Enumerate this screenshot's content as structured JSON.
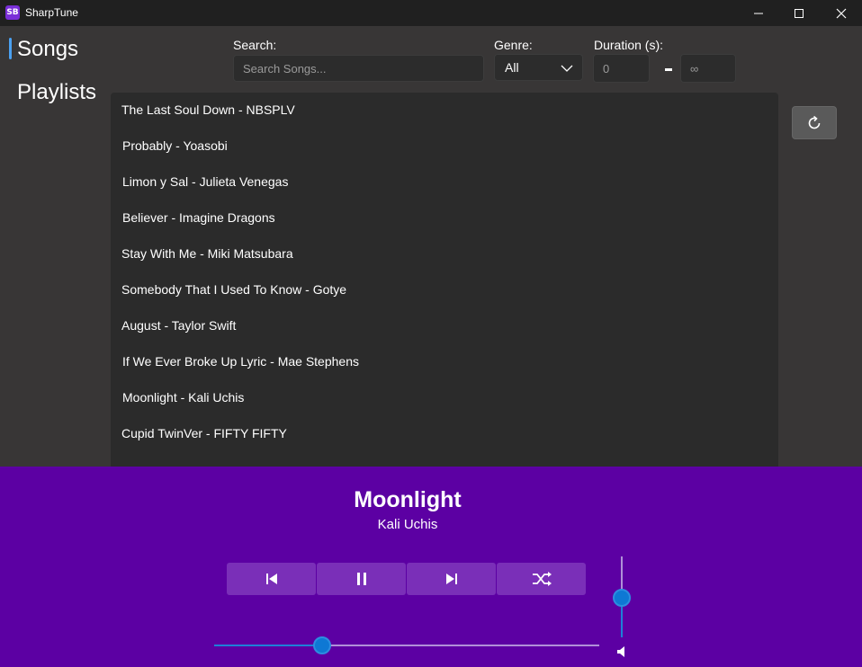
{
  "window": {
    "title": "SharpTune",
    "icon_text": "SB"
  },
  "nav": {
    "items": [
      {
        "label": "Songs",
        "selected": true
      },
      {
        "label": "Playlists",
        "selected": false
      }
    ]
  },
  "filters": {
    "search_label": "Search:",
    "search_placeholder": "Search Songs...",
    "genre_label": "Genre:",
    "genre_value": "All",
    "duration_label": "Duration (s):",
    "duration_min": "0",
    "duration_max": "∞"
  },
  "songs": [
    "The Last Soul Down - NBSPLV",
    "Probably - Yoasobi",
    "Limon y Sal - Julieta Venegas",
    "Believer - Imagine Dragons",
    "Stay With Me - Miki Matsubara",
    "Somebody That I Used To Know - Gotye",
    "August - Taylor Swift",
    "If We Ever Broke Up Lyric - Mae Stephens",
    "Moonlight - Kali Uchis",
    "Cupid TwinVer - FIFTY FIFTY"
  ],
  "player": {
    "title": "Moonlight",
    "artist": "Kali Uchis",
    "progress_fraction": 0.28,
    "volume_fraction": 0.5
  },
  "icons": {
    "refresh": "refresh-icon",
    "previous": "skip-previous-icon",
    "pause": "pause-icon",
    "next": "skip-next-icon",
    "shuffle": "shuffle-icon",
    "volume": "volume-icon"
  },
  "colors": {
    "player_bg": "#5c00a3",
    "control_bg": "#7a2fb8",
    "accent": "#0e78d4",
    "app_bg": "#383636",
    "list_bg": "#2b2b2b"
  }
}
